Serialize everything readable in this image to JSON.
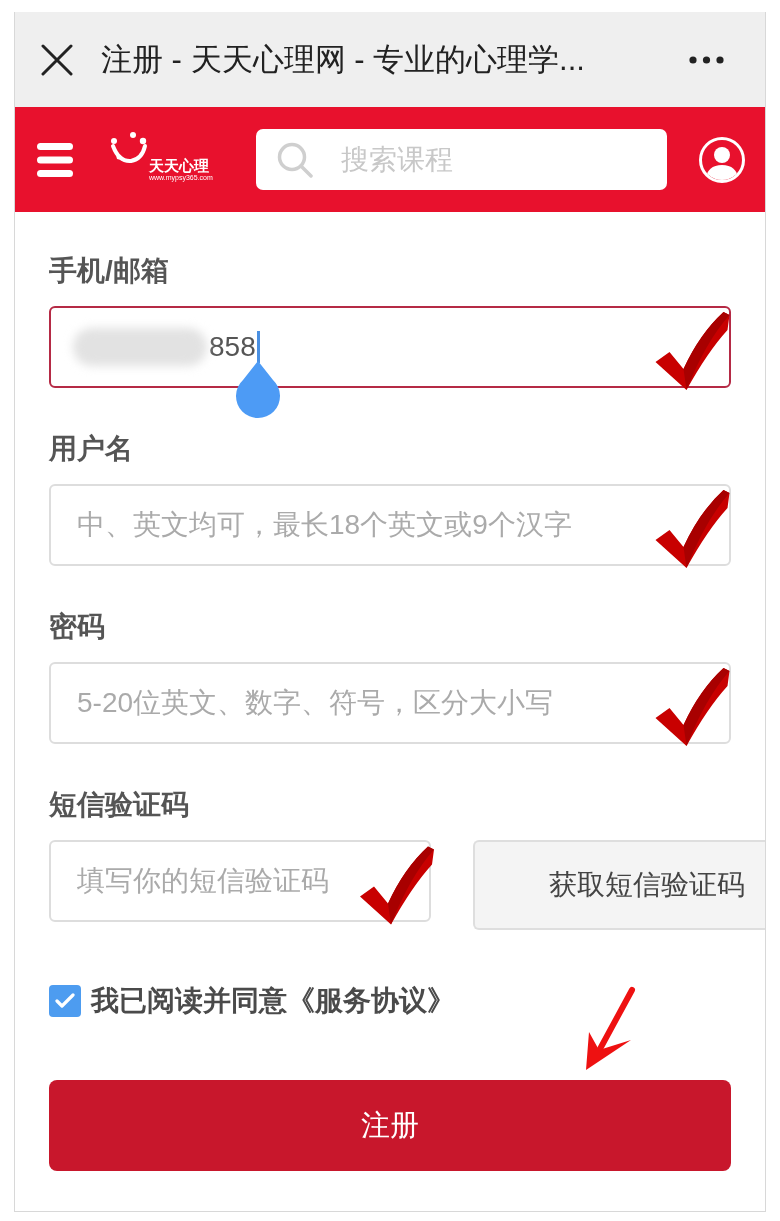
{
  "top_bar": {
    "title": "注册 - 天天心理网 - 专业的心理学..."
  },
  "header": {
    "logo": {
      "name": "天天心理",
      "url": "www.mypsy365.com"
    },
    "search": {
      "placeholder": "搜索课程"
    }
  },
  "form": {
    "fields": [
      {
        "kind": "input",
        "label": "手机/邮箱",
        "value": "858",
        "redacted": true,
        "focused": true,
        "marked": true
      },
      {
        "kind": "input",
        "label": "用户名",
        "placeholder": "中、英文均可，最长18个英文或9个汉字",
        "focused": false,
        "marked": true
      },
      {
        "kind": "input",
        "label": "密码",
        "placeholder": "5-20位英文、数字、符号，区分大小写",
        "focused": false,
        "marked": true
      },
      {
        "kind": "input_with_button",
        "label": "短信验证码",
        "placeholder": "填写你的短信验证码",
        "focused": false,
        "marked": true,
        "button": "获取短信验证码"
      }
    ],
    "agreement": {
      "checked": true,
      "text": "我已阅读并同意《服务协议》"
    },
    "arrow_mark": true,
    "submit_button": "注册"
  }
}
